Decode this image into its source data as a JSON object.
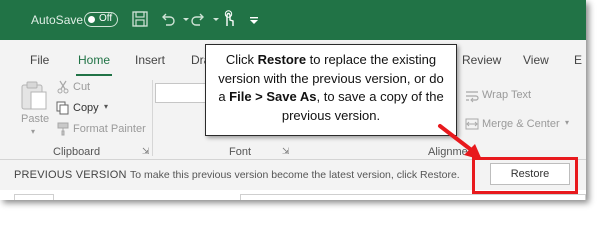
{
  "titlebar": {
    "autosave_label": "AutoSave",
    "autosave_state": "Off",
    "icons": [
      "save-icon",
      "undo-icon",
      "redo-icon",
      "touch-mode-icon",
      "customize-dropdown-icon"
    ]
  },
  "tabs": [
    {
      "label": "File"
    },
    {
      "label": "Home",
      "active": true
    },
    {
      "label": "Insert"
    },
    {
      "label": "Dra"
    },
    {
      "label": "Review"
    },
    {
      "label": "View"
    },
    {
      "label": "E"
    }
  ],
  "clipboard": {
    "paste": "Paste",
    "cut": "Cut",
    "copy": "Copy",
    "format_painter": "Format Painter",
    "group_label": "Clipboard"
  },
  "font": {
    "group_label": "Font"
  },
  "alignment": {
    "wrap_text": "Wrap Text",
    "merge_center": "Merge & Center",
    "group_label": "Alignme"
  },
  "callout": {
    "pre": "Click ",
    "restore": "Restore",
    "mid": " to replace the existing version with the previous version, or do a ",
    "file_save_as": "File > Save As",
    "post": ", to save a copy of the previous version."
  },
  "previous_version": {
    "title": "PREVIOUS VERSION",
    "message": "To make this previous version become the latest version, click Restore.",
    "restore_button": "Restore"
  },
  "colors": {
    "excel_green": "#217346",
    "highlight_red": "#e8191d",
    "arrow_red": "#e8191d"
  }
}
